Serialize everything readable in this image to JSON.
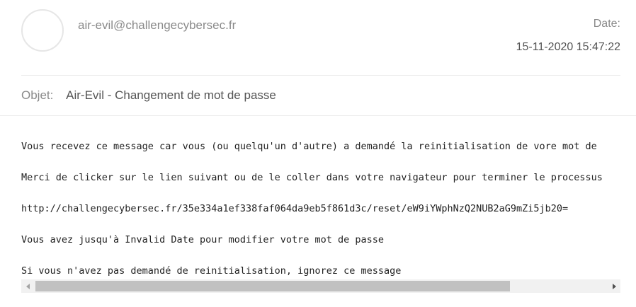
{
  "email": {
    "sender": "air-evil@challengecybersec.fr",
    "date_label": "Date:",
    "date_value": "15-11-2020 15:47:22",
    "subject_label": "Objet:",
    "subject": "Air-Evil - Changement de mot de passe"
  },
  "body": {
    "lines": [
      "Vous recevez ce message car vous (ou quelqu'un d'autre) a demandé la reinitialisation de vore mot de",
      "Merci de clicker sur le lien suivant ou de le coller dans votre navigateur pour terminer le processus",
      "http://challengecybersec.fr/35e334a1ef338faf064da9eb5f861d3c/reset/eW9iYWphNzQ2NUB2aG9mZi5jb20=",
      "Vous avez jusqu'à Invalid Date pour modifier votre mot de passe",
      "Si vous n'avez pas demandé de reinitialisation, ignorez ce message"
    ]
  },
  "scrollbar": {
    "left_arrow_icon": "triangle-left-icon",
    "right_arrow_icon": "triangle-right-icon",
    "scroll_position": 0
  }
}
